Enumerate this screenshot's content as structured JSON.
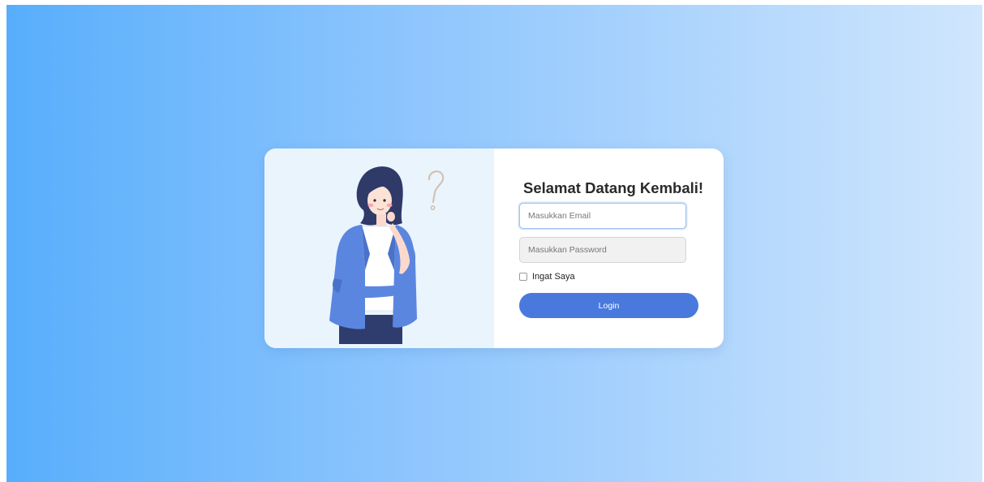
{
  "login": {
    "title": "Selamat Datang Kembali!",
    "email_placeholder": "Masukkan Email",
    "password_placeholder": "Masukkan Password",
    "remember_label": "Ingat Saya",
    "login_label": "Login"
  },
  "theme": {
    "gradient_start": "#58aefc",
    "gradient_end": "#d0e6fd",
    "button_color": "#4a79de",
    "panel_color": "#eaf4fd"
  },
  "illustration": {
    "icon": "thinking-woman-illustration"
  }
}
